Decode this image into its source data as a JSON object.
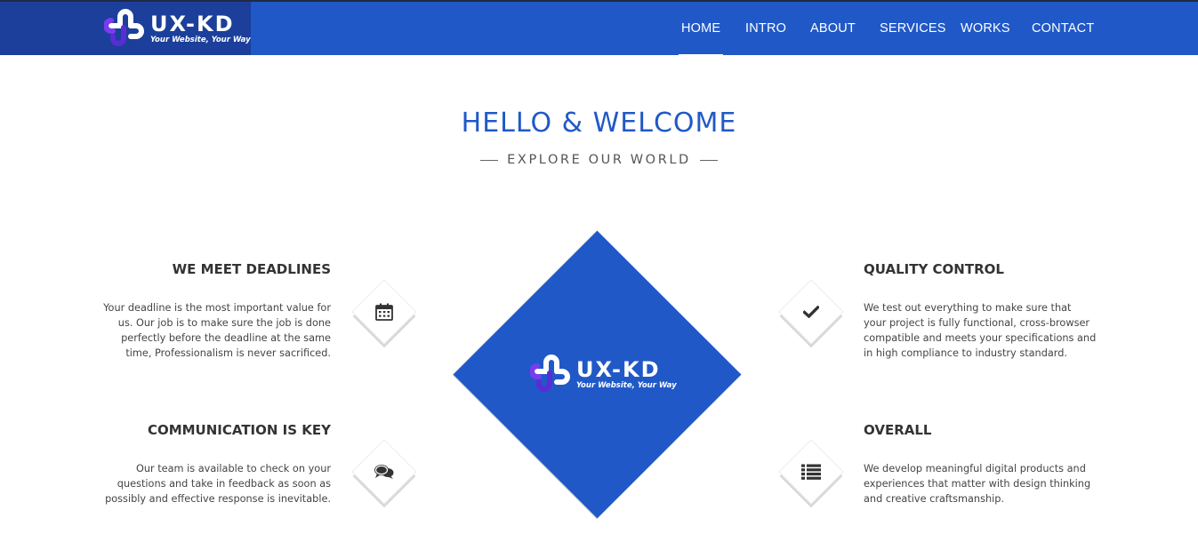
{
  "brand": {
    "name": "UX-KD",
    "tagline": "Your Website, Your Way"
  },
  "nav": {
    "items": [
      {
        "label": "HOME",
        "active": true
      },
      {
        "label": "INTRO",
        "active": false
      },
      {
        "label": "ABOUT",
        "active": false
      },
      {
        "label": "SERVICES",
        "active": false
      },
      {
        "label": "WORKS",
        "active": false
      },
      {
        "label": "CONTACT",
        "active": false
      }
    ]
  },
  "hero": {
    "title": "HELLO & WELCOME",
    "subtitle": "EXPLORE OUR WORLD"
  },
  "features": [
    {
      "title": "WE MEET DEADLINES",
      "text": "Your deadline is the most important value for us. Our job is to make sure the job is done perfectly before the deadline at the same time, Professionalism is never sacrificed.",
      "icon": "calendar-icon"
    },
    {
      "title": "COMMUNICATION IS KEY",
      "text": "Our team is available to check on your questions and take in feedback as soon as possibly and effective response is inevitable.",
      "icon": "chat-bubbles-icon"
    },
    {
      "title": "QUALITY CONTROL",
      "text": "We test out everything to make sure that your project is fully functional, cross-browser compatible and meets your specifications and in high compliance to industry standard.",
      "icon": "checkmark-icon"
    },
    {
      "title": "OVERALL",
      "text": "We develop meaningful digital products and experiences that matter with design thinking and creative craftsmanship.",
      "icon": "list-icon"
    }
  ],
  "colors": {
    "primary": "#2059c7",
    "brand_panel": "#1b3f9a",
    "logo_purple": "#5b2bd6",
    "text_dark": "#333333"
  }
}
